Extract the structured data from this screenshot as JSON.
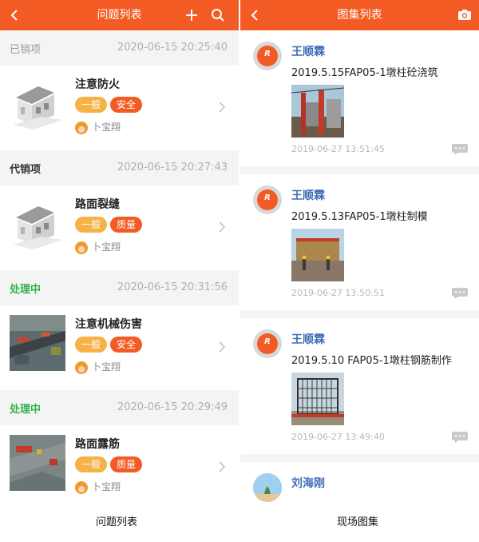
{
  "left": {
    "title": "问题列表",
    "sections": [
      {
        "status": "已销项",
        "time": "2020-06-15 20:25:40",
        "title": "注意防火",
        "level": "一般",
        "type": "安全",
        "reporter": "卜宝翔"
      },
      {
        "status": "代销项",
        "time": "2020-06-15 20:27:43",
        "title": "路面裂缝",
        "level": "一般",
        "type": "质量",
        "reporter": "卜宝翔"
      },
      {
        "status": "处理中",
        "time": "2020-06-15 20:31:56",
        "title": "注意机械伤害",
        "level": "一般",
        "type": "安全",
        "reporter": "卜宝翔"
      },
      {
        "status": "处理中",
        "time": "2020-06-15 20:29:49",
        "title": "路面露筋",
        "level": "一般",
        "type": "质量",
        "reporter": "卜宝翔"
      }
    ]
  },
  "right": {
    "title": "图集列表",
    "posts": [
      {
        "name": "王顺霖",
        "title": "2019.5.15FAP05-1墩柱砼浇筑",
        "time": "2019-06-27 13:51:45"
      },
      {
        "name": "王顺霖",
        "title": "2019.5.13FAP05-1墩柱制模",
        "time": "2019-06-27 13:50:51"
      },
      {
        "name": "王顺霖",
        "title": "2019.5.10 FAP05-1墩柱钢筋制作",
        "time": "2019-06-27 13:49:40"
      },
      {
        "name": "刘海刚"
      }
    ]
  },
  "captions": {
    "left": "问题列表",
    "right": "现场图集"
  },
  "colors": {
    "brand": "#f35b24",
    "level_tag": "#f6b147",
    "processing": "#31b24a",
    "name_link": "#3f6db5"
  },
  "icons": {
    "back": "chevron-left-icon",
    "add": "plus-icon",
    "search": "search-icon",
    "camera": "camera-icon",
    "comment": "comment-icon",
    "row_arrow": "chevron-right-icon"
  }
}
